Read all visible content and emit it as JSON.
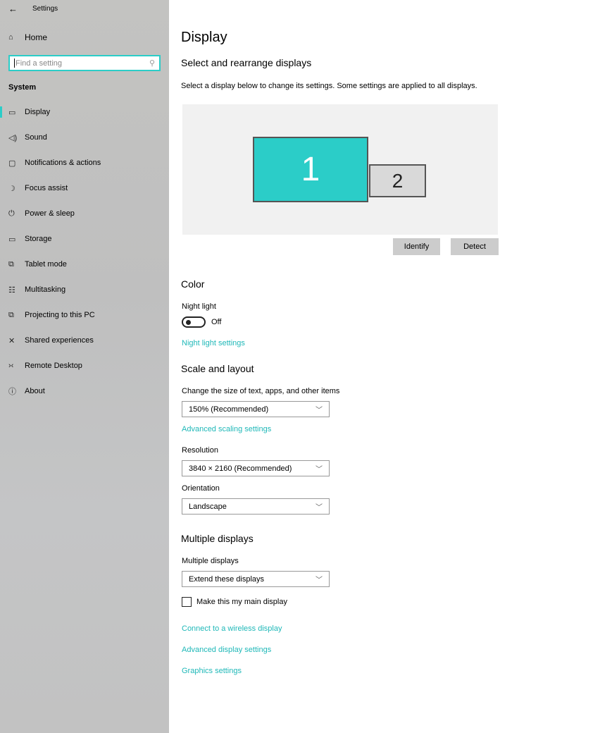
{
  "window": {
    "title": "Settings",
    "back_icon": "back-arrow-icon"
  },
  "sidebar": {
    "home": "Home",
    "search_placeholder": "Find a setting",
    "section": "System",
    "items": [
      {
        "label": "Display",
        "icon": "monitor-icon",
        "selected": true
      },
      {
        "label": "Sound",
        "icon": "speaker-icon"
      },
      {
        "label": "Notifications & actions",
        "icon": "notification-icon"
      },
      {
        "label": "Focus assist",
        "icon": "moon-icon"
      },
      {
        "label": "Power & sleep",
        "icon": "power-icon"
      },
      {
        "label": "Storage",
        "icon": "storage-icon"
      },
      {
        "label": "Tablet mode",
        "icon": "tablet-icon"
      },
      {
        "label": "Multitasking",
        "icon": "multitasking-icon"
      },
      {
        "label": "Projecting to this PC",
        "icon": "projecting-icon"
      },
      {
        "label": "Shared experiences",
        "icon": "shared-icon"
      },
      {
        "label": "Remote Desktop",
        "icon": "remote-desktop-icon"
      },
      {
        "label": "About",
        "icon": "info-icon"
      }
    ]
  },
  "main": {
    "title": "Display",
    "arrange": {
      "heading": "Select and rearrange displays",
      "desc": "Select a display below to change its settings. Some settings are applied to all displays.",
      "monitor1": "1",
      "monitor2": "2",
      "identify": "Identify",
      "detect": "Detect"
    },
    "color": {
      "heading": "Color",
      "night_light_label": "Night light",
      "night_light_state": "Off",
      "night_light_link": "Night light settings"
    },
    "scale": {
      "heading": "Scale and layout",
      "size_label": "Change the size of text, apps, and other items",
      "size_value": "150% (Recommended)",
      "advanced_link": "Advanced scaling settings",
      "resolution_label": "Resolution",
      "resolution_value": "3840 × 2160 (Recommended)",
      "orientation_label": "Orientation",
      "orientation_value": "Landscape"
    },
    "multiple": {
      "heading": "Multiple displays",
      "label": "Multiple displays",
      "value": "Extend these displays",
      "main_display_label": "Make this my main display",
      "main_display_checked": false,
      "links": [
        "Connect to a wireless display",
        "Advanced display settings",
        "Graphics settings"
      ]
    }
  },
  "colors": {
    "accent": "#2bcdc8",
    "link": "#1fb8b8"
  }
}
